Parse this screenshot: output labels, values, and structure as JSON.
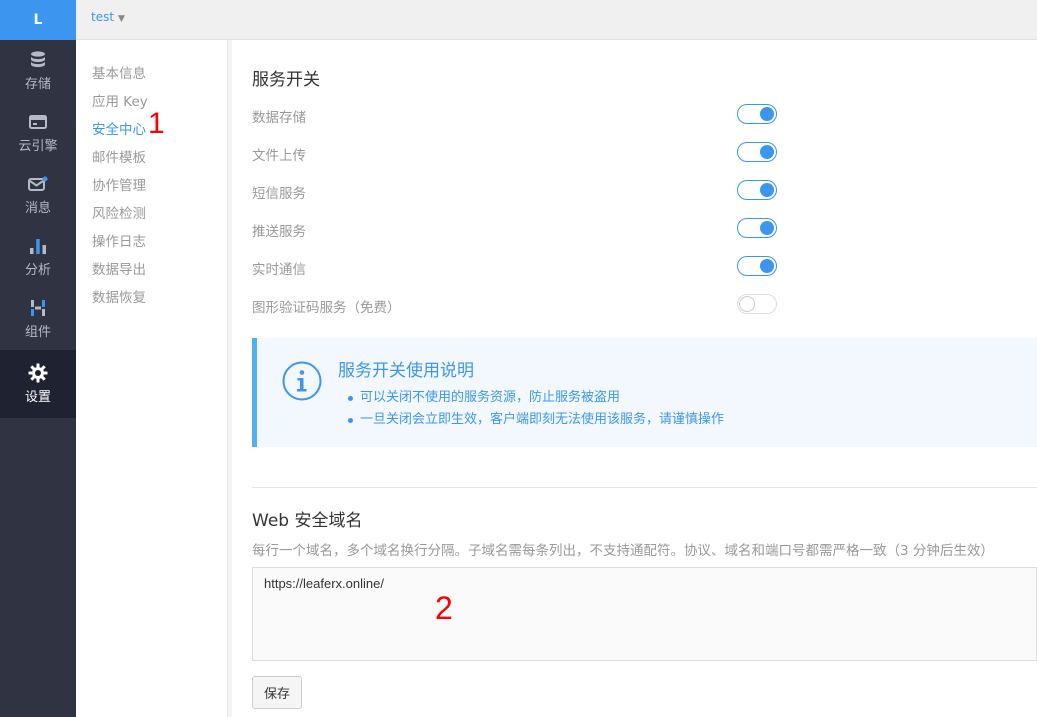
{
  "nav": {
    "logo": "L",
    "items": [
      {
        "label": "存储",
        "icon": "database-icon"
      },
      {
        "label": "云引擎",
        "icon": "cloud-engine-icon"
      },
      {
        "label": "消息",
        "icon": "message-icon"
      },
      {
        "label": "分析",
        "icon": "bar-chart-icon"
      },
      {
        "label": "组件",
        "icon": "components-icon"
      },
      {
        "label": "设置",
        "icon": "gear-icon"
      }
    ]
  },
  "topbar": {
    "app_name": "test"
  },
  "subnav": {
    "items": [
      "基本信息",
      "应用 Key",
      "安全中心",
      "邮件模板",
      "协作管理",
      "风险检测",
      "操作日志",
      "数据导出",
      "数据恢复"
    ]
  },
  "annotations": {
    "mark1": "1",
    "mark2": "2"
  },
  "services": {
    "title": "服务开关",
    "items": [
      {
        "label": "数据存储",
        "on": true
      },
      {
        "label": "文件上传",
        "on": true
      },
      {
        "label": "短信服务",
        "on": true
      },
      {
        "label": "推送服务",
        "on": true
      },
      {
        "label": "实时通信",
        "on": true
      },
      {
        "label": "图形验证码服务（免费）",
        "on": false
      }
    ]
  },
  "info": {
    "title": "服务开关使用说明",
    "lines": [
      "可以关闭不使用的服务资源，防止服务被盗用",
      "一旦关闭会立即生效，客户端即刻无法使用该服务，请谨慎操作"
    ]
  },
  "domain": {
    "title": "Web 安全域名",
    "description": "每行一个域名，多个域名换行分隔。子域名需每条列出，不支持通配符。协议、域名和端口号都需严格一致（3 分钟后生效）",
    "value": "https://leaferx.online/",
    "save_label": "保存"
  },
  "colors": {
    "accent": "#3c96f0",
    "nav_bg": "#2f3342",
    "nav_active": "#1f2230",
    "annotation": "#ff0000"
  }
}
